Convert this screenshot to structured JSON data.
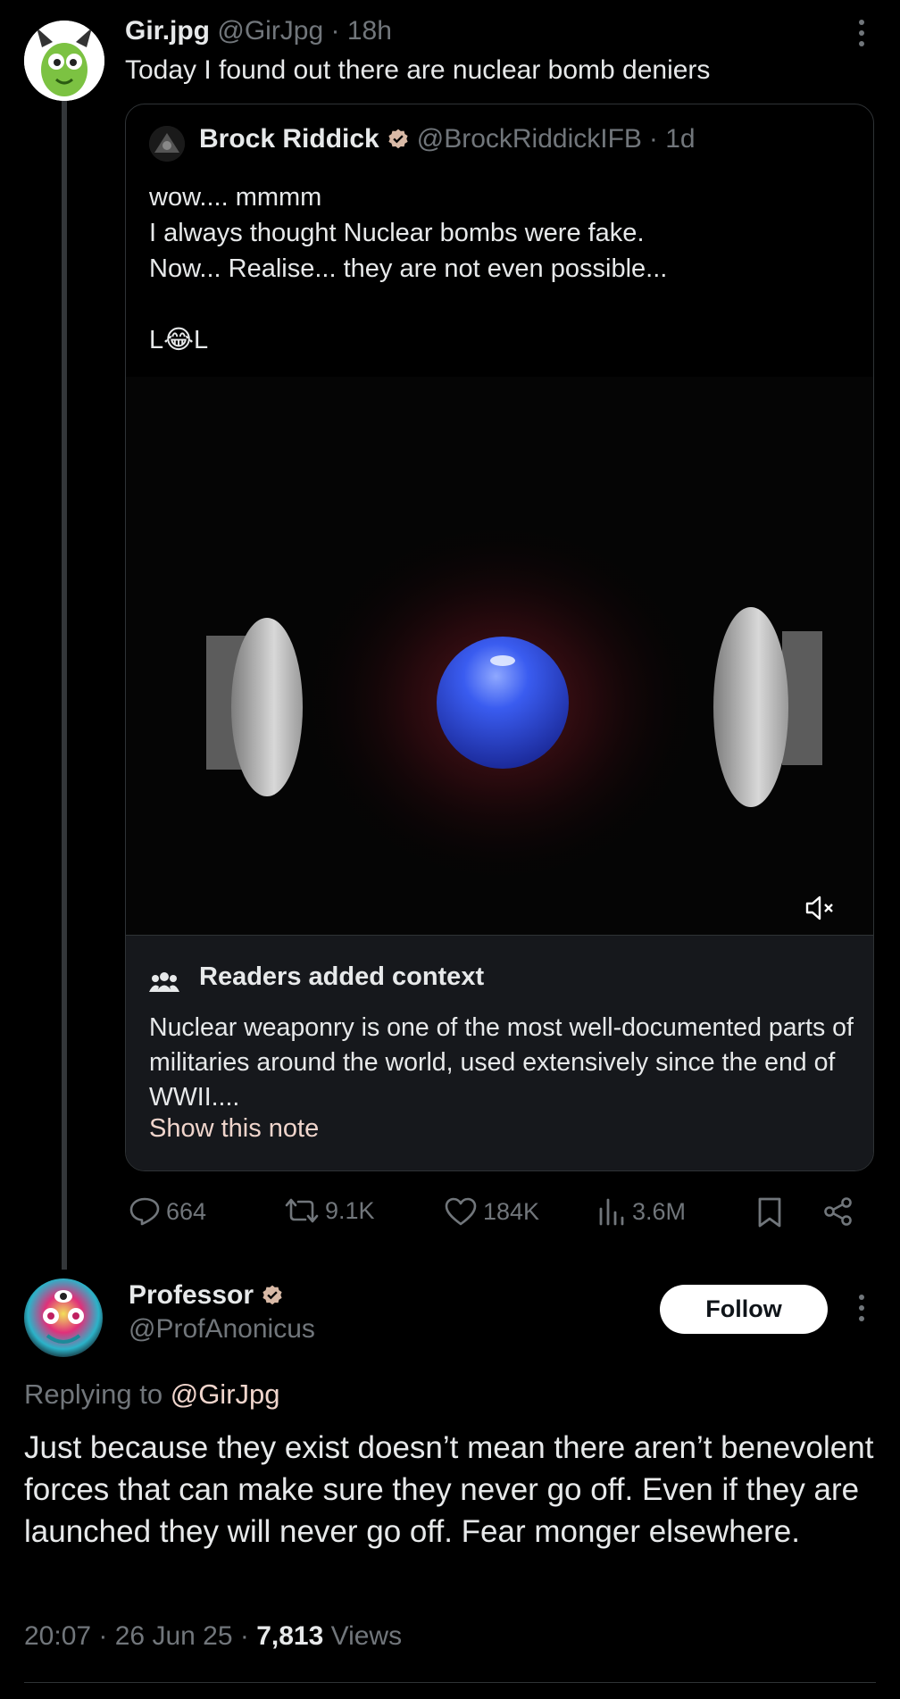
{
  "post": {
    "author_name": "Gir.jpg",
    "author_handle": "@GirJpg",
    "time": "· 18h",
    "text": "Today I found out there are nuclear bomb deniers"
  },
  "quote": {
    "author_name": "Brock Riddick",
    "author_handle": "@BrockRiddickIFB",
    "time": "· 1d",
    "text": "wow.... mmmm\nI always thought Nuclear bombs were fake.\nNow... Realise... they are not even possible...\n\nL😂L"
  },
  "context": {
    "title": "Readers added context",
    "body": "Nuclear weaponry is one of the most well-documented parts of militaries around the world, used extensively since the end of WWII....",
    "link": "Show this note"
  },
  "actions": {
    "replies": "664",
    "reposts": "9.1K",
    "likes": "184K",
    "views": "3.6M"
  },
  "reply": {
    "author_name": "Professor",
    "author_handle": "@ProfAnonicus",
    "follow_label": "Follow",
    "replying_prefix": "Replying to",
    "replying_mention": "@GirJpg",
    "text": "Just because they exist doesn’t mean there aren’t benevolent forces that can make sure they never go off. Even if they are launched they will never go off. Fear monger elsewhere.",
    "time": "20:07 · 26 Jun 25 ·",
    "views_count": "7,813",
    "views_label": "Views"
  },
  "colors": {
    "background": "#000000",
    "text": "#e7e9ea",
    "muted": "#71767b",
    "border": "#2f3336",
    "context_bg": "#16181c",
    "link": "#f0d5cc",
    "verified": "#d8b9a6"
  },
  "icons": [
    "more-icon",
    "verified-icon",
    "mute-icon",
    "community-notes-icon",
    "reply-icon",
    "repost-icon",
    "like-icon",
    "views-icon",
    "bookmark-icon",
    "share-icon"
  ]
}
